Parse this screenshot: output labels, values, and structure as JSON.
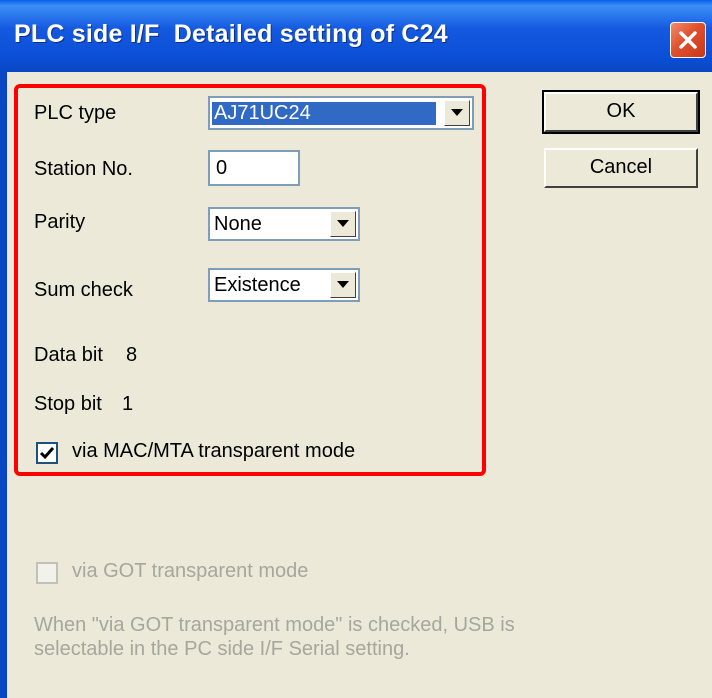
{
  "window": {
    "title": "PLC side I/F  Detailed setting of C24"
  },
  "fields": {
    "plc_type": {
      "label": "PLC type",
      "value": "AJ71UC24"
    },
    "station_no": {
      "label": "Station No.",
      "value": "0"
    },
    "parity": {
      "label": "Parity",
      "value": "None"
    },
    "sum_check": {
      "label": "Sum check",
      "value": "Existence"
    },
    "data_bit": {
      "label": "Data bit",
      "value": "8"
    },
    "stop_bit": {
      "label": "Stop bit",
      "value": "1"
    },
    "mac_mta_mode": {
      "label": "via MAC/MTA transparent mode",
      "checked": true
    },
    "got_mode": {
      "label": "via GOT transparent mode",
      "checked": false,
      "enabled": false
    }
  },
  "buttons": {
    "ok": "OK",
    "cancel": "Cancel"
  },
  "note": {
    "line1": "When \"via GOT transparent mode\" is checked, USB is",
    "line2": " selectable in the PC side I/F  Serial setting."
  },
  "colors": {
    "titlebar": "#0A5FEA",
    "highlight_box": "#FF0000",
    "selection": "#316AC5",
    "dialog_bg": "#ECE9D8"
  },
  "icons": {
    "close": "close-icon",
    "dropdown": "chevron-down-icon",
    "check": "check-icon"
  }
}
